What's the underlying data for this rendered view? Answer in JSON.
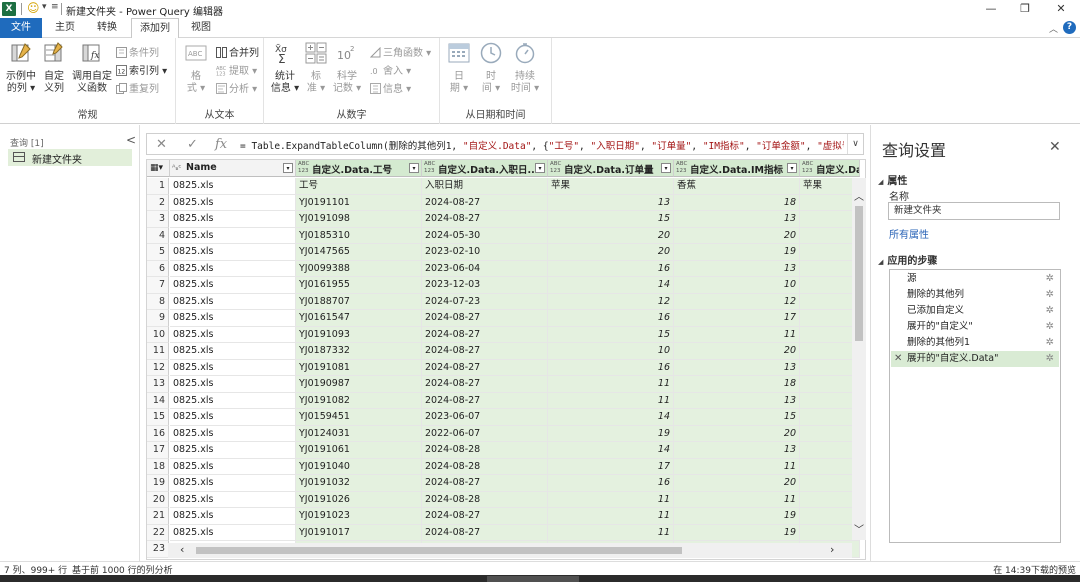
{
  "titlebar": {
    "app_icon": "X",
    "title": "新建文件夹 - Power Query 编辑器",
    "minimize_icon": "—",
    "maximize_icon": "❐",
    "close_icon": "✕"
  },
  "tabs": [
    "文件",
    "主页",
    "转换",
    "添加列",
    "视图"
  ],
  "ribbon": {
    "groups": {
      "general": {
        "label": "常规",
        "example_col": [
          "示例中",
          "的列 ▾"
        ],
        "custom_col": [
          "自定",
          "义列"
        ],
        "invoke_func": [
          "调用自定",
          "义函数"
        ],
        "cond_col": "条件列",
        "index_col": "索引列 ▾",
        "dup_col": "重复列"
      },
      "from_text": {
        "label": "从文本",
        "format": [
          "格",
          "式 ▾"
        ],
        "merge": "合并列",
        "extract": "提取 ▾",
        "parse": "分析 ▾"
      },
      "from_number": {
        "label": "从数字",
        "stats": [
          "统计",
          "信息 ▾"
        ],
        "standard": [
          "标",
          "准 ▾"
        ],
        "scientific": [
          "科学",
          "记数 ▾"
        ],
        "trig": "三角函数 ▾",
        "round": "舍入 ▾",
        "info": "信息 ▾"
      },
      "from_datetime": {
        "label": "从日期和时间",
        "date": [
          "日",
          "期 ▾"
        ],
        "time": [
          "时",
          "间 ▾"
        ],
        "duration": [
          "持续",
          "时间 ▾"
        ]
      }
    }
  },
  "queries": {
    "header": "查询 [1]",
    "collapse": "<",
    "items": [
      "新建文件夹"
    ]
  },
  "formula": {
    "cancel": "✕",
    "commit": "✓",
    "fx": "fx",
    "text_parts": [
      {
        "t": "= Table.ExpandTableColumn(删除的其他列1, ",
        "s": false
      },
      {
        "t": "\"自定义.Data\"",
        "s": true
      },
      {
        "t": ", {",
        "s": false
      },
      {
        "t": "\"工号\"",
        "s": true
      },
      {
        "t": ", ",
        "s": false
      },
      {
        "t": "\"入职日期\"",
        "s": true
      },
      {
        "t": ", ",
        "s": false
      },
      {
        "t": "\"订单量\"",
        "s": true
      },
      {
        "t": ", ",
        "s": false
      },
      {
        "t": "\"IM指标\"",
        "s": true
      },
      {
        "t": ", ",
        "s": false
      },
      {
        "t": "\"订单金额\"",
        "s": true
      },
      {
        "t": ", ",
        "s": false
      },
      {
        "t": "\"虚拟号指标",
        "s": true
      }
    ],
    "expand": "∨"
  },
  "grid": {
    "columns": [
      {
        "type": "A^B_C",
        "name": "Name",
        "w": 126,
        "green": false
      },
      {
        "type": "ABC 123",
        "name": "自定义.Data.工号",
        "w": 126,
        "green": true
      },
      {
        "type": "ABC 123",
        "name": "自定义.Data.入职日...",
        "w": 126,
        "green": true
      },
      {
        "type": "ABC 123",
        "name": "自定义.Data.订单量",
        "w": 126,
        "green": true
      },
      {
        "type": "ABC 123",
        "name": "自定义.Data.IM指标",
        "w": 126,
        "green": true
      },
      {
        "type": "ABC 123",
        "name": "自定义.Dat",
        "w": 60,
        "green": true
      }
    ],
    "rows": [
      [
        "1",
        "0825.xls",
        "工号",
        "入职日期",
        "苹果",
        "香蕉",
        "苹果"
      ],
      [
        "2",
        "0825.xls",
        "YJ0191101",
        "2024-08-27",
        "13",
        "18",
        ""
      ],
      [
        "3",
        "0825.xls",
        "YJ0191098",
        "2024-08-27",
        "15",
        "13",
        ""
      ],
      [
        "4",
        "0825.xls",
        "YJ0185310",
        "2024-05-30",
        "20",
        "20",
        ""
      ],
      [
        "5",
        "0825.xls",
        "YJ0147565",
        "2023-02-10",
        "20",
        "19",
        ""
      ],
      [
        "6",
        "0825.xls",
        "YJ0099388",
        "2023-06-04",
        "16",
        "13",
        ""
      ],
      [
        "7",
        "0825.xls",
        "YJ0161955",
        "2023-12-03",
        "14",
        "10",
        ""
      ],
      [
        "8",
        "0825.xls",
        "YJ0188707",
        "2024-07-23",
        "12",
        "12",
        ""
      ],
      [
        "9",
        "0825.xls",
        "YJ0161547",
        "2024-08-27",
        "16",
        "17",
        ""
      ],
      [
        "10",
        "0825.xls",
        "YJ0191093",
        "2024-08-27",
        "15",
        "11",
        ""
      ],
      [
        "11",
        "0825.xls",
        "YJ0187332",
        "2024-08-27",
        "10",
        "20",
        ""
      ],
      [
        "12",
        "0825.xls",
        "YJ0191081",
        "2024-08-27",
        "16",
        "13",
        ""
      ],
      [
        "13",
        "0825.xls",
        "YJ0190987",
        "2024-08-27",
        "11",
        "18",
        ""
      ],
      [
        "14",
        "0825.xls",
        "YJ0191082",
        "2024-08-27",
        "11",
        "13",
        ""
      ],
      [
        "15",
        "0825.xls",
        "YJ0159451",
        "2023-06-07",
        "14",
        "15",
        ""
      ],
      [
        "16",
        "0825.xls",
        "YJ0124031",
        "2022-06-07",
        "19",
        "20",
        ""
      ],
      [
        "17",
        "0825.xls",
        "YJ0191061",
        "2024-08-28",
        "14",
        "13",
        ""
      ],
      [
        "18",
        "0825.xls",
        "YJ0191040",
        "2024-08-28",
        "17",
        "11",
        ""
      ],
      [
        "19",
        "0825.xls",
        "YJ0191032",
        "2024-08-27",
        "16",
        "20",
        ""
      ],
      [
        "20",
        "0825.xls",
        "YJ0191026",
        "2024-08-28",
        "11",
        "11",
        ""
      ],
      [
        "21",
        "0825.xls",
        "YJ0191023",
        "2024-08-27",
        "11",
        "19",
        ""
      ],
      [
        "22",
        "0825.xls",
        "YJ0191017",
        "2024-08-27",
        "11",
        "19",
        ""
      ],
      [
        "23",
        "",
        "",
        "",
        "",
        "",
        ""
      ]
    ]
  },
  "settings": {
    "title": "查询设置",
    "close": "✕",
    "props_header": "属性",
    "name_label": "名称",
    "name_value": "新建文件夹",
    "all_props": "所有属性",
    "steps_header": "应用的步骤",
    "steps": [
      "源",
      "删除的其他列",
      "已添加自定义",
      "展开的\"自定义\"",
      "删除的其他列1",
      "展开的\"自定义.Data\""
    ],
    "selected_step": 5
  },
  "status": {
    "left": "7 列、999+ 行",
    "middle": "基于前 1000 行的列分析",
    "right": "在 14:39下载的预览"
  },
  "colors": {
    "accent": "#1f6bbd",
    "excel_green": "#1d6f42",
    "selected_green": "#d4ead0"
  }
}
